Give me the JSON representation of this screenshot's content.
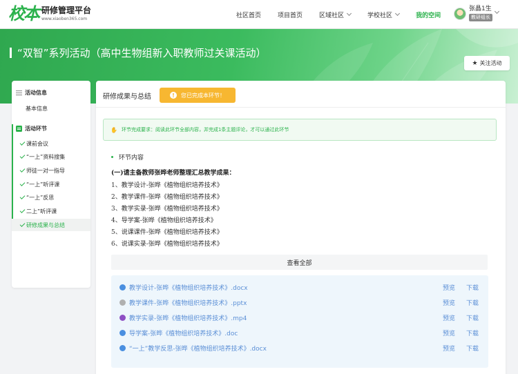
{
  "brand": {
    "logo_mark": "校本",
    "title": "研修管理平台",
    "url": "www.xiaoben365.com"
  },
  "nav": {
    "items": [
      {
        "label": "社区首页",
        "dropdown": false,
        "active": false
      },
      {
        "label": "项目首页",
        "dropdown": false,
        "active": false
      },
      {
        "label": "区域社区",
        "dropdown": true,
        "active": false
      },
      {
        "label": "学校社区",
        "dropdown": true,
        "active": false
      },
      {
        "label": "我的空间",
        "dropdown": false,
        "active": true
      }
    ],
    "active_color": "#2bb24c"
  },
  "user": {
    "name": "张晶1生",
    "role": "教研组长"
  },
  "banner": {
    "title": "“双智”系列活动（高中生物组新入职教师过关课活动）",
    "follow_label": "关注活动",
    "follow_icon": "star-icon"
  },
  "sidebar": {
    "info_header": "活动信息",
    "info_items": [
      "基本信息"
    ],
    "stage_header": "活动环节",
    "stages": [
      {
        "label": "课前会议",
        "done": true,
        "active": false
      },
      {
        "label": "“一上”资料搜集",
        "done": true,
        "active": false
      },
      {
        "label": "师徒一对一指导",
        "done": true,
        "active": false
      },
      {
        "label": "“一上”听评课",
        "done": true,
        "active": false
      },
      {
        "label": "“一上”反思",
        "done": true,
        "active": false
      },
      {
        "label": "二上”听评课",
        "done": true,
        "active": false
      },
      {
        "label": "研修成果与总结",
        "done": true,
        "active": true
      }
    ]
  },
  "main": {
    "title": "研修成果与总结",
    "done_label": "您已完成本环节！",
    "notice": "环节完成要求：阅读此环节全部内容，并完成1条主题评论，才可以通过此环节",
    "section_label": "环节内容",
    "content_head": "(一)请主备教师张晔老师整理汇总教学成果：",
    "content_lines": [
      "1、教学设计-张晔《植物组织培养技术》",
      "2、教学课件-张晔《植物组织培养技术》",
      "3、教学实录-张晔《植物组织培养技术》",
      "4、导学案-张晔《植物组织培养技术》",
      "5、说课课件-张晔《植物组织培养技术》",
      "6、说课实录-张晔《植物组织培养技术》"
    ],
    "view_all": "查看全部",
    "preview_label": "预览",
    "download_label": "下载",
    "files": [
      {
        "name": "教学设计-张晔《植物组织培养技术》.docx",
        "icon": "word-file-icon",
        "icon_color": "#4a8fe0"
      },
      {
        "name": "教学课件-张晔《植物组织培养技术》.pptx",
        "icon": "ppt-file-icon",
        "icon_color": "#b0b0b0"
      },
      {
        "name": "教学实录-张晔《植物组织培养技术》.mp4",
        "icon": "video-file-icon",
        "icon_color": "#8e4fc4"
      },
      {
        "name": "导学案-张晔《植物组织培养技术》.doc",
        "icon": "word-file-icon",
        "icon_color": "#4a8fe0"
      },
      {
        "name": "“一上”教学反思-张晔《植物组织培养技术》.docx",
        "icon": "word-file-icon",
        "icon_color": "#4a8fe0"
      }
    ]
  },
  "colors": {
    "primary_green": "#2bb24c",
    "warning_orange": "#f7b731",
    "link_blue": "#5b8fd6"
  }
}
